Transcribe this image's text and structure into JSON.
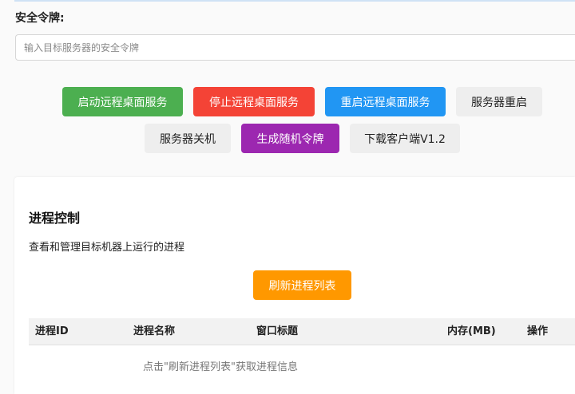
{
  "token": {
    "label": "安全令牌:",
    "placeholder": "输入目标服务器的安全令牌"
  },
  "actions": {
    "start_rdp": "启动远程桌面服务",
    "stop_rdp": "停止远程桌面服务",
    "restart_rdp": "重启远程桌面服务",
    "server_restart": "服务器重启",
    "server_shutdown": "服务器关机",
    "gen_token": "生成随机令牌",
    "download_client": "下载客户端V1.2"
  },
  "colors": {
    "green": "#4caf50",
    "red": "#f44336",
    "blue": "#2196f3",
    "gray": "#eeeeee",
    "purple": "#9c27b0",
    "orange": "#ff9800"
  },
  "process": {
    "title": "进程控制",
    "description": "查看和管理目标机器上运行的进程",
    "refresh_label": "刷新进程列表",
    "columns": {
      "pid": "进程ID",
      "name": "进程名称",
      "window_title": "窗口标题",
      "memory": "内存(MB)",
      "actions": "操作"
    },
    "empty_message": "点击\"刷新进程列表\"获取进程信息"
  }
}
